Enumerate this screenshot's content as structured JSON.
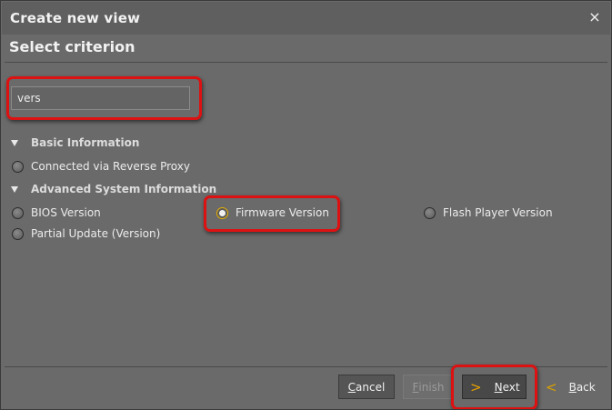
{
  "window": {
    "title": "Create new view",
    "close_icon": "×"
  },
  "page": {
    "subtitle": "Select criterion"
  },
  "search": {
    "value": "vers",
    "placeholder": ""
  },
  "sections": [
    {
      "label": "Basic Information",
      "items": [
        {
          "label": "Connected via Reverse Proxy",
          "selected": false
        }
      ]
    },
    {
      "label": "Advanced System Information",
      "items": [
        {
          "label": "BIOS Version",
          "selected": false
        },
        {
          "label": "Firmware Version",
          "selected": true
        },
        {
          "label": "Flash Player Version",
          "selected": false
        },
        {
          "label": "Partial Update (Version)",
          "selected": false
        }
      ]
    }
  ],
  "buttons": {
    "cancel": {
      "mnemonic": "C",
      "rest": "ancel",
      "enabled": true
    },
    "finish": {
      "mnemonic": "F",
      "rest": "inish",
      "enabled": false
    },
    "next": {
      "mnemonic": "N",
      "rest": "ext",
      "icon": "chevron-right-icon",
      "glyph": ">"
    },
    "back": {
      "mnemonic": "B",
      "rest": "ack",
      "icon": "chevron-left-icon",
      "glyph": "<"
    }
  },
  "colors": {
    "background": "#6a6a6a",
    "highlight": "#dd1111",
    "accent": "#e8a000"
  }
}
